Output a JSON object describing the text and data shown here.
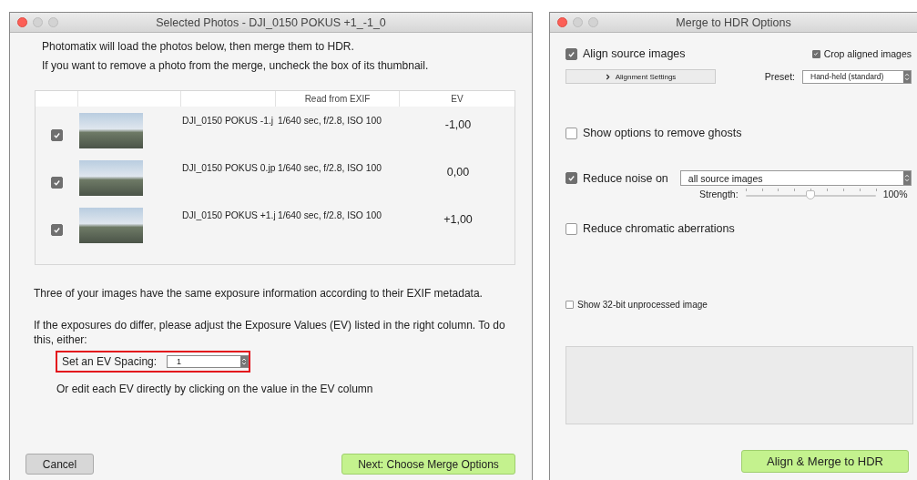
{
  "selected_photos_window": {
    "title": "Selected Photos - DJI_0150 POKUS +1_-1_0",
    "intro": [
      "Photomatix will load the photos below, then merge them to HDR.",
      "If you want to remove a photo from the merge, uncheck the box of its thumbnail."
    ],
    "table": {
      "columns": [
        "Read from EXIF",
        "EV"
      ],
      "rows": [
        {
          "checked": true,
          "filename": "DJI_0150 POKUS -1.j",
          "exif": "1/640 sec, f/2.8, ISO 100",
          "ev": "-1,00"
        },
        {
          "checked": true,
          "filename": "DJI_0150 POKUS 0.jp",
          "exif": "1/640 sec, f/2.8, ISO 100",
          "ev": "0,00"
        },
        {
          "checked": true,
          "filename": "DJI_0150 POKUS +1.j",
          "exif": "1/640 sec, f/2.8, ISO 100",
          "ev": "+1,00"
        }
      ]
    },
    "note": "Three of your images have the same exposure information according to their EXIF metadata.",
    "instruction": "If the exposures do differ, please adjust the Exposure Values (EV) listed in the right column. To do this, either:",
    "ev_spacing": {
      "label": "Set an EV Spacing:",
      "value": "1",
      "highlighted": true
    },
    "alternative": "Or edit each EV directly by clicking on the value in the EV column",
    "buttons": {
      "cancel": "Cancel",
      "next": "Next: Choose Merge Options"
    }
  },
  "merge_options_window": {
    "title": "Merge to HDR Options",
    "align": {
      "label": "Align source images",
      "checked": true
    },
    "crop": {
      "label": "Crop aligned images",
      "checked": true
    },
    "alignment_settings": "Alignment Settings",
    "preset": {
      "label": "Preset:",
      "value": "Hand-held (standard)"
    },
    "ghosts": {
      "label": "Show options to remove ghosts",
      "checked": false
    },
    "reduce_noise": {
      "label": "Reduce noise on",
      "checked": true,
      "value": "all source images"
    },
    "strength": {
      "label": "Strength:",
      "level": 0.5,
      "reading": "100%"
    },
    "chromatic": {
      "label": "Reduce chromatic aberrations",
      "checked": false
    },
    "show_32bit": {
      "label": "Show 32-bit unprocessed image",
      "checked": false
    },
    "button": "Align & Merge to HDR"
  }
}
